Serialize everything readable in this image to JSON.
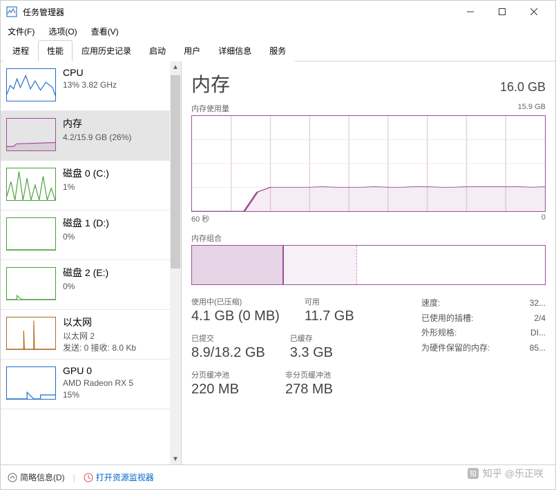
{
  "window": {
    "title": "任务管理器"
  },
  "menu": {
    "file": "文件(F)",
    "options": "选项(O)",
    "view": "查看(V)"
  },
  "tabs": [
    "进程",
    "性能",
    "应用历史记录",
    "启动",
    "用户",
    "详细信息",
    "服务"
  ],
  "active_tab": 1,
  "sidebar": [
    {
      "title": "CPU",
      "sub": "13% 3.82 GHz",
      "color": "#1e6cc7"
    },
    {
      "title": "内存",
      "sub": "4.2/15.9 GB (26%)",
      "color": "#9b4f96",
      "selected": true
    },
    {
      "title": "磁盘 0 (C:)",
      "sub": "1%",
      "color": "#4a9e3a"
    },
    {
      "title": "磁盘 1 (D:)",
      "sub": "0%",
      "color": "#4a9e3a"
    },
    {
      "title": "磁盘 2 (E:)",
      "sub": "0%",
      "color": "#4a9e3a"
    },
    {
      "title": "以太网",
      "sub1": "以太网 2",
      "sub2": "发送: 0 接收: 8.0 Kb",
      "color": "#b06a1e"
    },
    {
      "title": "GPU 0",
      "sub1": "AMD Radeon RX 5",
      "sub2": "15%",
      "color": "#1e6cc7"
    }
  ],
  "main": {
    "title": "内存",
    "total": "16.0 GB",
    "usage_label": "内存使用量",
    "usage_max": "15.9 GB",
    "axis_left": "60 秒",
    "axis_right": "0",
    "comp_label": "内存组合",
    "stats": {
      "inuse_label": "使用中(已压缩)",
      "inuse_value": "4.1 GB (0 MB)",
      "avail_label": "可用",
      "avail_value": "11.7 GB",
      "committed_label": "已提交",
      "committed_value": "8.9/18.2 GB",
      "cached_label": "已缓存",
      "cached_value": "3.3 GB",
      "paged_label": "分页缓冲池",
      "paged_value": "220 MB",
      "nonpaged_label": "非分页缓冲池",
      "nonpaged_value": "278 MB"
    },
    "details": {
      "speed_label": "速度:",
      "speed_value": "32...",
      "slots_label": "已使用的插槽:",
      "slots_value": "2/4",
      "form_label": "外形规格:",
      "form_value": "DI...",
      "reserved_label": "为硬件保留的内存:",
      "reserved_value": "85..."
    }
  },
  "statusbar": {
    "fewer": "简略信息(D)",
    "resmon": "打开资源监视器"
  },
  "watermark": "知乎 @乐正咲",
  "chart_data": {
    "type": "line",
    "title": "内存使用量",
    "ylabel": "GB",
    "ylim": [
      0,
      15.9
    ],
    "xlim_seconds": [
      60,
      0
    ],
    "series": [
      {
        "name": "内存",
        "values_gb": [
          0,
          0,
          0,
          0,
          0,
          3.2,
          4.0,
          4.0,
          4.0,
          4.0,
          4.1,
          4.0,
          4.0,
          4.0,
          4.1,
          4.0,
          4.0,
          4.1,
          4.1,
          4.0,
          4.0,
          4.1,
          4.1,
          4.1,
          4.1,
          4.1,
          4.0,
          4.1
        ]
      }
    ],
    "composition_gb": {
      "inuse": 4.1,
      "standby": 3.3,
      "free": 8.5,
      "total": 15.9
    }
  }
}
